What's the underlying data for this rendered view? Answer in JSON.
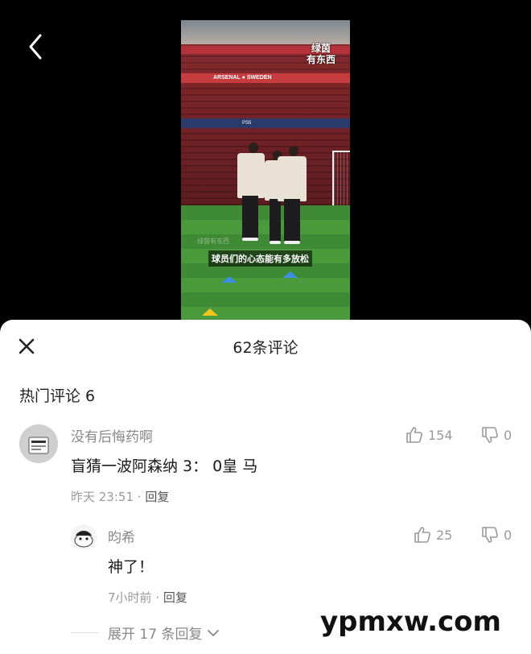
{
  "video": {
    "watermark_line1": "绿茵",
    "watermark_line2": "有东西",
    "subtitle": "球员们的心态能有多放松",
    "faint_watermark": "绿茵有东西",
    "stadium_banner": "ARSENAL ● SWEDEN",
    "stand_sign": "PS5"
  },
  "header": {
    "title": "62条评论"
  },
  "hot_section": {
    "label": "热门评论 6"
  },
  "comments": [
    {
      "username": "没有后悔药啊",
      "text": "盲猜一波阿森纳 3： 0皇 马",
      "time": "昨天 23:51",
      "reply_label": "回复",
      "likes": "154",
      "dislikes": "0"
    },
    {
      "username": "昀希",
      "text": "神了！",
      "time": "7小时前",
      "reply_label": "回复",
      "likes": "25",
      "dislikes": "0"
    }
  ],
  "expand": {
    "label": "展开 17 条回复"
  },
  "site_watermark": "ypmxw.com",
  "colors": {
    "background": "#000000",
    "sheet": "#ffffff",
    "muted_text": "#999999",
    "primary_text": "#1a1a1a"
  }
}
